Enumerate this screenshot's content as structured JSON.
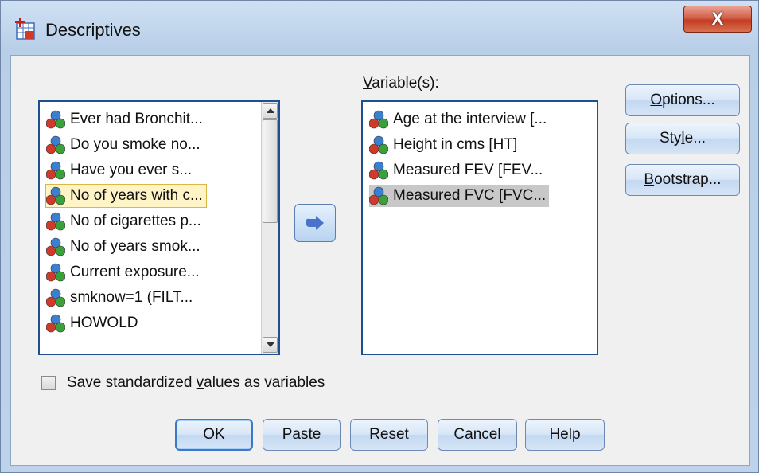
{
  "window": {
    "title": "Descriptives",
    "close_glyph": "X"
  },
  "source_list": {
    "items": [
      "Ever had Bronchit...",
      "Do you smoke no...",
      "Have you ever s...",
      "No of years with c...",
      "No of cigarettes p...",
      "No of years smok...",
      "Current exposure...",
      "smknow=1 (FILT...",
      "HOWOLD"
    ],
    "focused_index": 3,
    "item_icon": "variable-scale-icon"
  },
  "target_list": {
    "label": "Variable(s):",
    "items": [
      "Age at the interview [...",
      "Height in cms [HT]",
      "Measured FEV [FEV...",
      "Measured FVC [FVC..."
    ],
    "selected_index": 3
  },
  "move_button": {
    "icon": "arrow-right-icon"
  },
  "side_buttons": {
    "options": "Options...",
    "style": "Style...",
    "bootstrap": "Bootstrap..."
  },
  "save_checkbox": {
    "label": "Save standardized values as variables",
    "checked": false
  },
  "bottom_buttons": {
    "ok": "OK",
    "paste": "Paste",
    "reset": "Reset",
    "cancel": "Cancel",
    "help": "Help"
  },
  "colors": {
    "accent": "#3c78c8",
    "arrow": "#4a72c8",
    "focus_bg": "#fff4c6",
    "selected_bg": "#c8c8c8"
  }
}
